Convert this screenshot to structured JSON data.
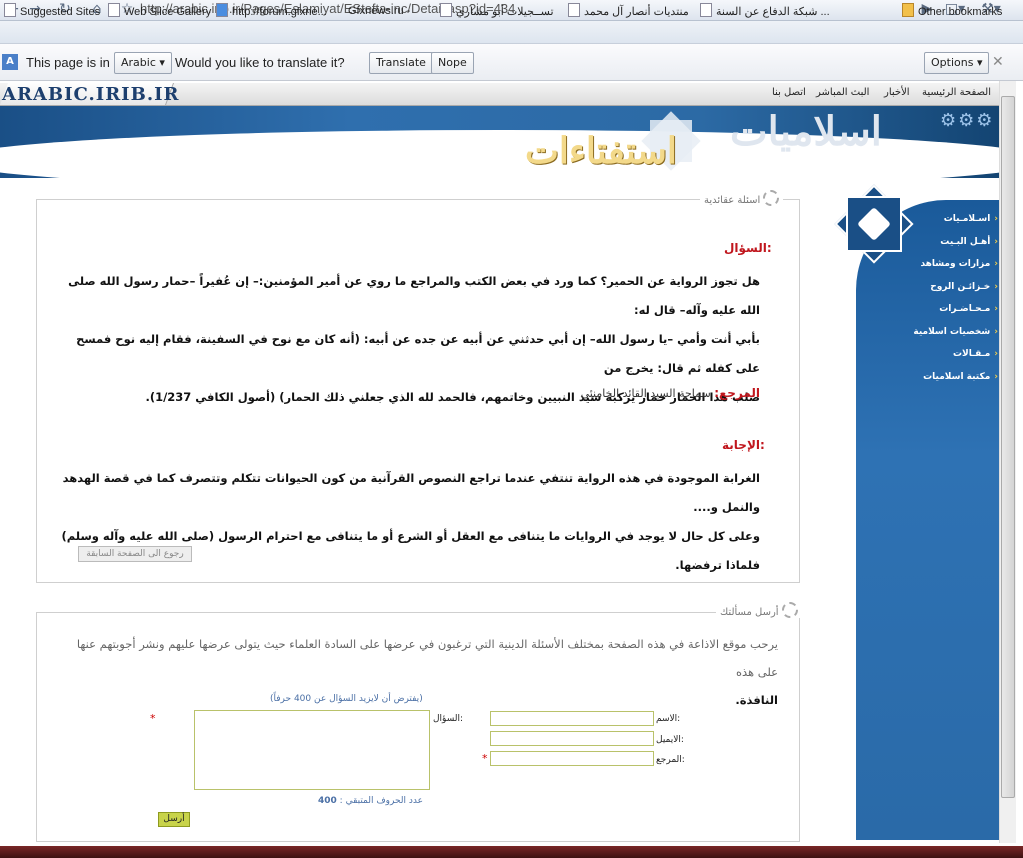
{
  "browser": {
    "url": "http://arabic.irib.ir/Pages/Eslamiyat/EStefta-inc/Detail.asp?id=434",
    "bookmarks": [
      "Suggested Sites",
      "Web Slice Gallery",
      "http://forum.gfxne...",
      "Gfxnews.ru -",
      "تســجيلات أبو مشاري",
      "منتديات أنصار آل محمد",
      "شبكة الدفاع عن السنة ...",
      "Other bookmarks"
    ],
    "translate": {
      "prefix": "This page is in",
      "language": "Arabic",
      "question": "Would you like to translate it?",
      "translate_btn": "Translate",
      "nope_btn": "Nope",
      "options_btn": "Options"
    }
  },
  "site": {
    "logo": "ARABIC.IRIB.IR",
    "topnav": [
      "الصفحة الرئيسية",
      "الأخبار",
      "البث المباشر",
      "اتصل بنا"
    ],
    "banner_title_1": "اسلاميات",
    "banner_title_2": "استفتاءات"
  },
  "sidebar": [
    "اسـلامـيات",
    "أهـل البـيت",
    "مزارات ومشاهد",
    "خـزائـن الروح",
    "مـحـاضـرات",
    "شخصيات اسلامية",
    "مـقـالات",
    "مكتبة اسلاميات"
  ],
  "box1": {
    "legend": "اسئلة عقائدية",
    "question_label": "السؤال:",
    "question_lines": [
      "هل تجوز الرواية عن الحمير؟ كما ورد في بعض الكتب والمراجع ما روي عن أمير المؤمنين:– إن عُفيراً –حمار رسول الله صلى الله عليه وآله– قال له:",
      "بأبي أنت وأمي –يا رسول الله– إن أبي حدثني عن أبيه عن جده عن أبيه: (أنه كان مع نوح في السفينة، فقام إليه نوح فمسح على كفله ثم قال: يخرج من",
      "صلب هذا الحمار حمار يركبه سيد النبيين وخاتمهم، فالحمد لله الذي جعلني ذلك الحمار) (أصول الكافي 1/237)."
    ],
    "reference_label": "المرجع:",
    "reference_value": "سماحة السيد القائد الخامنئي",
    "answer_label": "الإجابة:",
    "answer_lines": [
      "الغرابة الموجودة في هذه الرواية تنتفي عندما تراجع النصوص القرآنية من كون الحيوانات تتكلم وتتصرف كما في قصة الهدهد والنمل و....",
      "وعلى كل حال لا يوجد في الروايات ما يتنافى مع العقل أو الشرع أو ما يتنافى مع احترام الرسول (صلى الله عليه وآله وسلم) فلماذا ترفضها."
    ],
    "back_btn": "رجوع الى الصفحة السابقة"
  },
  "box2": {
    "legend": "أرسل مسألتك",
    "intro": "يرحب موقع الاذاعة في هذه الصفحة بمختلف الأسئلة الدينية التي ترغبون في عرضها على السادة العلماء حيث يتولى عرضها عليهم ونشر أجوبتهم عنها على هذه",
    "intro_end": "النافذة.",
    "hint": "(يفترض أن لايزيد السؤال عن 400 حرفاً)",
    "name_label": "الاسم:",
    "email_label": "الايميل:",
    "reference_label": "المرجع:",
    "question_label": "السؤال:",
    "remaining_label": "عدد الحروف المتبقي :",
    "remaining_value": "400",
    "send_btn": "أرسل",
    "required_mark": "*"
  }
}
